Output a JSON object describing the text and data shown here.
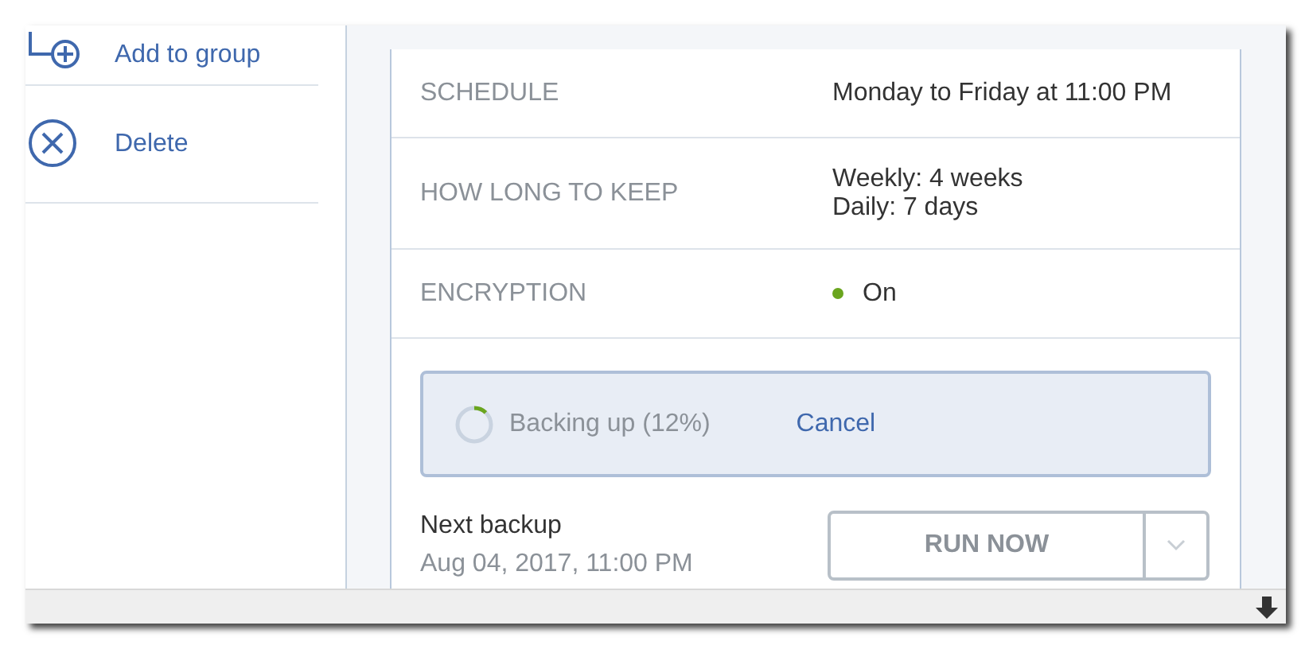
{
  "sidebar": {
    "items": [
      {
        "label": "Add to group",
        "kind": "add-group"
      },
      {
        "label": "Delete",
        "kind": "delete"
      }
    ]
  },
  "details": {
    "rows": [
      {
        "label": "SCHEDULE",
        "values": [
          "Monday to Friday at 11:00 PM"
        ]
      },
      {
        "label": "HOW LONG TO KEEP",
        "values": [
          "Weekly: 4 weeks",
          "Daily: 7 days"
        ]
      },
      {
        "label": "ENCRYPTION",
        "values": [
          "On"
        ],
        "color": "#6aa51e"
      }
    ]
  },
  "progress": {
    "label": "Backing up (12%)",
    "level": 0.12,
    "action": "Cancel"
  },
  "next_backup": {
    "label": "Next backup",
    "date": "Aug 04, 2017, 11:00 PM"
  },
  "run_button": {
    "label": "RUN NOW"
  }
}
